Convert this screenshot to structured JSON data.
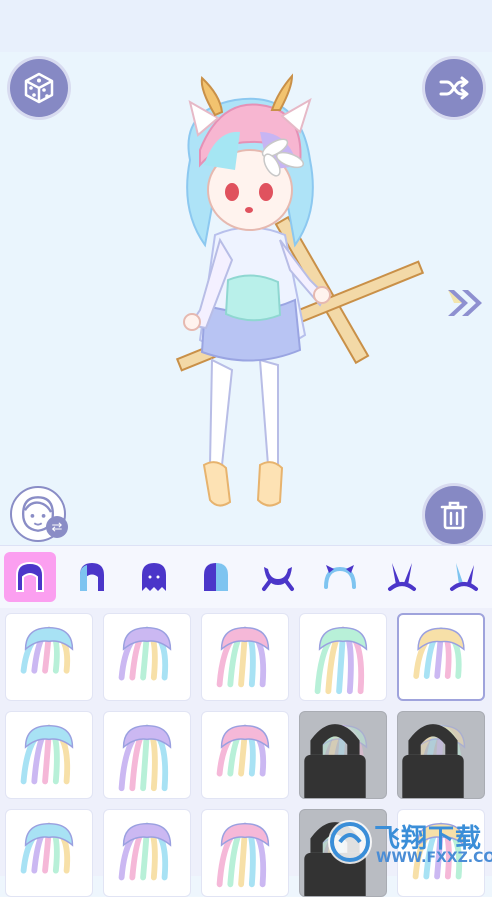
{
  "toolbar": {
    "random_icon": "dice-icon",
    "shuffle_icon": "shuffle-icon",
    "next_icon": "double-chevron-right-icon",
    "avatar_icon": "face-swap-icon",
    "delete_icon": "trash-icon"
  },
  "tabs": [
    {
      "icon": "hair-full-icon",
      "active": true
    },
    {
      "icon": "hair-front-icon",
      "active": false
    },
    {
      "icon": "hair-back-icon",
      "active": false
    },
    {
      "icon": "hair-split-color-icon",
      "active": false
    },
    {
      "icon": "horns-icon",
      "active": false
    },
    {
      "icon": "headband-icon",
      "active": false
    },
    {
      "icon": "bunny-ears-icon",
      "active": false
    },
    {
      "icon": "bunny-ears-alt-icon",
      "active": false
    }
  ],
  "grid": {
    "items": [
      {
        "name": "hair-style-1",
        "locked": false,
        "selected": false
      },
      {
        "name": "hair-style-2",
        "locked": false,
        "selected": false
      },
      {
        "name": "hair-style-3",
        "locked": false,
        "selected": false
      },
      {
        "name": "hair-style-4",
        "locked": false,
        "selected": false
      },
      {
        "name": "hair-style-5",
        "locked": false,
        "selected": true
      },
      {
        "name": "hair-style-6",
        "locked": false,
        "selected": false
      },
      {
        "name": "hair-style-7",
        "locked": false,
        "selected": false
      },
      {
        "name": "hair-style-8",
        "locked": false,
        "selected": false
      },
      {
        "name": "hair-style-9",
        "locked": true,
        "selected": false
      },
      {
        "name": "hair-style-10",
        "locked": true,
        "selected": false
      },
      {
        "name": "hair-style-11",
        "locked": false,
        "selected": false
      },
      {
        "name": "hair-style-12",
        "locked": false,
        "selected": false
      },
      {
        "name": "hair-style-13",
        "locked": false,
        "selected": false
      },
      {
        "name": "hair-style-14",
        "locked": true,
        "selected": false
      },
      {
        "name": "hair-style-15",
        "locked": false,
        "selected": false
      }
    ]
  },
  "watermark": {
    "text": "飞翔下载",
    "url": "WWW.FXXZ.COM"
  },
  "colors": {
    "accent": "#8689c4",
    "active_tab": "#fb9ff0",
    "tab_icon": "#4b36c9"
  }
}
